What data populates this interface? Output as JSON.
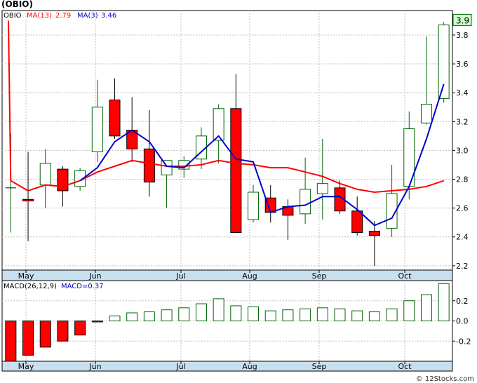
{
  "title": "(OBIO)",
  "watermark": "© 12Stocks.com",
  "colors": {
    "up": "#006400",
    "down": "#ff0000",
    "ma13": "#ff0000",
    "ma3": "#0000cc",
    "macd": "#006400",
    "axis_band": "#c8dff0",
    "grid": "#bfbfbf"
  },
  "chart_data": [
    {
      "type": "candlestick",
      "legend": {
        "ticker": "OBIO",
        "ma13": "MA(13)",
        "ma13_value": "2.79",
        "ma3": "MA(3)",
        "ma3_value": "3.46"
      },
      "last_price_label": "3.9",
      "ylim": [
        2.17,
        3.97
      ],
      "yticks": [
        2.2,
        2.4,
        2.6,
        2.8,
        3.0,
        3.2,
        3.4,
        3.6,
        3.8
      ],
      "ytick_labels": [
        "2.2",
        "2.4",
        "2.6",
        "2.8",
        "3.0",
        "3.2",
        "3.4",
        "3.6",
        "3.8"
      ],
      "xtick_labels": [
        "May",
        "Jun",
        "Jul",
        "Aug",
        "Sep",
        "Oct"
      ],
      "grid": true,
      "candles": [
        {
          "o": 2.74,
          "h": 3.12,
          "l": 2.43,
          "c": 2.74
        },
        {
          "o": 2.66,
          "h": 2.99,
          "l": 2.37,
          "c": 2.65
        },
        {
          "o": 2.76,
          "h": 3.01,
          "l": 2.6,
          "c": 2.91
        },
        {
          "o": 2.87,
          "h": 2.89,
          "l": 2.61,
          "c": 2.72
        },
        {
          "o": 2.75,
          "h": 2.88,
          "l": 2.72,
          "c": 2.86
        },
        {
          "o": 2.99,
          "h": 3.49,
          "l": 2.92,
          "c": 3.3
        },
        {
          "o": 3.35,
          "h": 3.5,
          "l": 3.08,
          "c": 3.1
        },
        {
          "o": 3.14,
          "h": 3.37,
          "l": 2.92,
          "c": 3.01
        },
        {
          "o": 3.01,
          "h": 3.28,
          "l": 2.68,
          "c": 2.78
        },
        {
          "o": 2.83,
          "h": 2.92,
          "l": 2.6,
          "c": 2.93
        },
        {
          "o": 2.87,
          "h": 2.96,
          "l": 2.81,
          "c": 2.93
        },
        {
          "o": 2.94,
          "h": 3.16,
          "l": 2.87,
          "c": 3.1
        },
        {
          "o": 3.07,
          "h": 3.32,
          "l": 2.91,
          "c": 3.29
        },
        {
          "o": 3.29,
          "h": 3.53,
          "l": 2.43,
          "c": 2.43
        },
        {
          "o": 2.52,
          "h": 2.76,
          "l": 2.5,
          "c": 2.71
        },
        {
          "o": 2.67,
          "h": 2.76,
          "l": 2.5,
          "c": 2.57
        },
        {
          "o": 2.61,
          "h": 2.66,
          "l": 2.38,
          "c": 2.55
        },
        {
          "o": 2.56,
          "h": 2.95,
          "l": 2.49,
          "c": 2.73
        },
        {
          "o": 2.7,
          "h": 3.08,
          "l": 2.52,
          "c": 2.77
        },
        {
          "o": 2.74,
          "h": 2.79,
          "l": 2.56,
          "c": 2.58
        },
        {
          "o": 2.58,
          "h": 2.68,
          "l": 2.41,
          "c": 2.43
        },
        {
          "o": 2.44,
          "h": 2.51,
          "l": 2.2,
          "c": 2.41
        },
        {
          "o": 2.46,
          "h": 2.9,
          "l": 2.4,
          "c": 2.7
        },
        {
          "o": 2.75,
          "h": 3.27,
          "l": 2.66,
          "c": 3.15
        },
        {
          "o": 3.19,
          "h": 3.79,
          "l": 3.18,
          "c": 3.32
        },
        {
          "o": 3.36,
          "h": 3.89,
          "l": 3.33,
          "c": 3.87
        }
      ],
      "ma13": [
        2.79,
        2.72,
        2.76,
        2.75,
        2.79,
        2.85,
        2.89,
        2.93,
        2.91,
        2.89,
        2.89,
        2.9,
        2.93,
        2.91,
        2.9,
        2.88,
        2.88,
        2.85,
        2.82,
        2.77,
        2.73,
        2.71,
        2.72,
        2.73,
        2.75,
        2.79
      ],
      "ma3": [
        null,
        null,
        null,
        null,
        2.79,
        2.88,
        3.06,
        3.14,
        3.06,
        2.89,
        2.88,
        2.99,
        3.1,
        2.94,
        2.92,
        2.57,
        2.61,
        2.62,
        2.68,
        2.68,
        2.59,
        2.48,
        2.53,
        2.75,
        3.08,
        3.46
      ]
    },
    {
      "type": "bar",
      "legend": {
        "name": "MACD(26,12,9)",
        "value_label": "MACD=0.37"
      },
      "ylim": [
        -0.4,
        0.4
      ],
      "yticks": [
        -0.2,
        0.0,
        0.2
      ],
      "ytick_labels": [
        "-0.2",
        "0.0",
        "0.2"
      ],
      "xtick_labels": [
        "May",
        "Jun",
        "Jul",
        "Aug",
        "Sep",
        "Oct"
      ],
      "values": [
        -0.4,
        -0.34,
        -0.26,
        -0.2,
        -0.14,
        -0.01,
        0.05,
        0.08,
        0.09,
        0.11,
        0.13,
        0.17,
        0.22,
        0.15,
        0.14,
        0.1,
        0.11,
        0.12,
        0.13,
        0.12,
        0.1,
        0.09,
        0.12,
        0.2,
        0.26,
        0.37
      ]
    }
  ]
}
